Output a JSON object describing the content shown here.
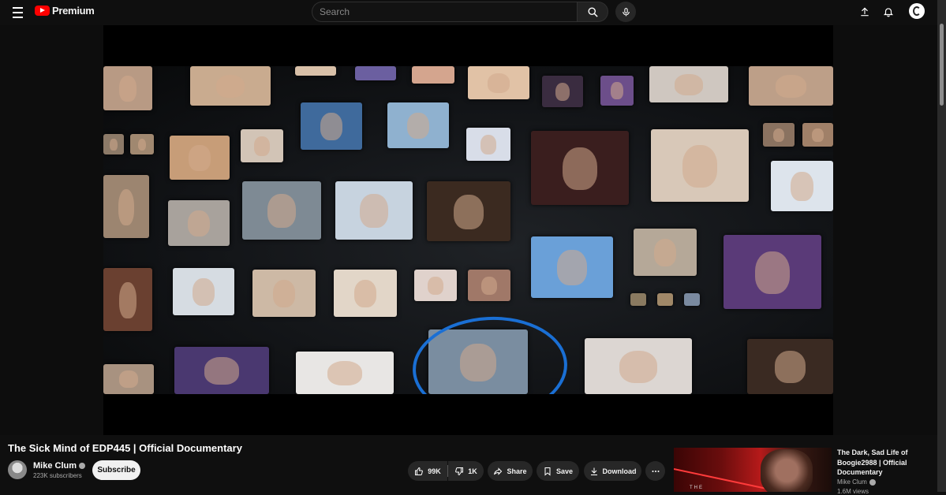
{
  "header": {
    "logo_text": "Premium",
    "search_placeholder": "Search"
  },
  "video": {
    "title": "The Sick Mind of EDP445 | Official Documentary",
    "channel": {
      "name": "Mike Clum",
      "subscribers": "223K subscribers"
    },
    "subscribe_label": "Subscribe",
    "actions": {
      "likes": "99K",
      "dislikes": "1K",
      "share": "Share",
      "save": "Save",
      "download": "Download"
    }
  },
  "recommendation": {
    "title": "The Dark, Sad Life of Boogie2988 | Official Documentary",
    "channel": "Mike Clum",
    "thumb_text": "THE",
    "meta": "1.6M views"
  },
  "colors": {
    "brand_red": "#ff0000",
    "circle_blue": "#1a6fd4",
    "background": "#0f0f0f"
  },
  "icons": [
    "menu-icon",
    "search-icon",
    "mic-icon",
    "upload-icon",
    "bell-icon",
    "like-icon",
    "dislike-icon",
    "share-icon",
    "save-icon",
    "download-icon",
    "more-icon",
    "verified-icon"
  ]
}
